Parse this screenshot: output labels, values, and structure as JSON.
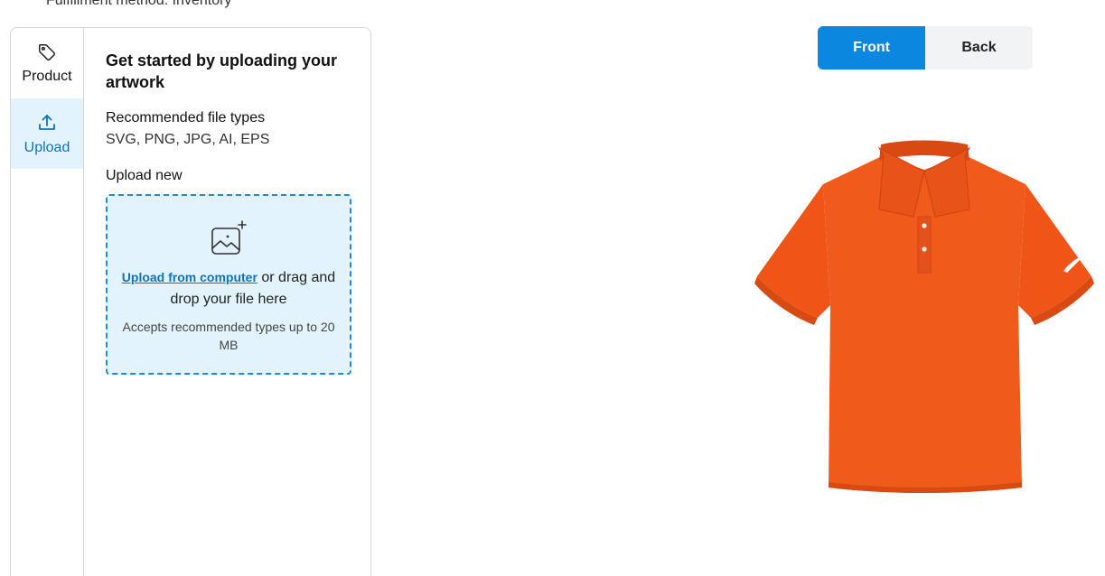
{
  "header": {
    "fulfillment_label": "Fulfillment method: Inventory"
  },
  "sidebar": {
    "items": [
      {
        "label": "Product",
        "icon": "tag-icon",
        "active": false
      },
      {
        "label": "Upload",
        "icon": "upload-icon",
        "active": true
      }
    ]
  },
  "upload_panel": {
    "heading": "Get started by uploading your artwork",
    "recommended_label": "Recommended file types",
    "recommended_types": "SVG, PNG, JPG, AI, EPS",
    "upload_new_label": "Upload new",
    "dropzone": {
      "icon": "image-add-icon",
      "link_text": "Upload from computer",
      "drag_text": " or drag and drop your file here",
      "accepts_text": "Accepts recommended types up to 20 MB"
    }
  },
  "preview": {
    "tabs": [
      {
        "label": "Front",
        "active": true
      },
      {
        "label": "Back",
        "active": false
      }
    ],
    "product_image": "orange-polo-shirt",
    "colors": {
      "accent": "#0b87e0",
      "shirt": "#f05a1a",
      "active_rail": "#e2f3fb"
    }
  }
}
